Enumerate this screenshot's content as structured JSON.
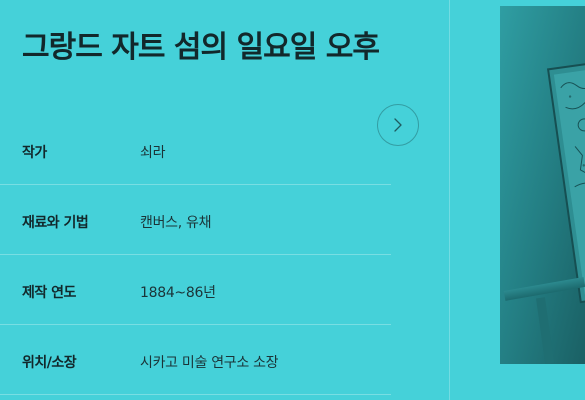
{
  "title": "그랑드 자트 섬의 일요일 오후",
  "next_button": {
    "icon": "chevron-right-icon"
  },
  "details": [
    {
      "label": "작가",
      "value": "쇠라"
    },
    {
      "label": "재료와 기법",
      "value": "캔버스, 유채"
    },
    {
      "label": "제작 연도",
      "value": "1884~86년"
    },
    {
      "label": "위치/소장",
      "value": "시카고 미술 연구소 소장"
    }
  ],
  "colors": {
    "background": "#45d1d9",
    "text": "#12282b",
    "artwork_tint": "#2a8f93"
  }
}
